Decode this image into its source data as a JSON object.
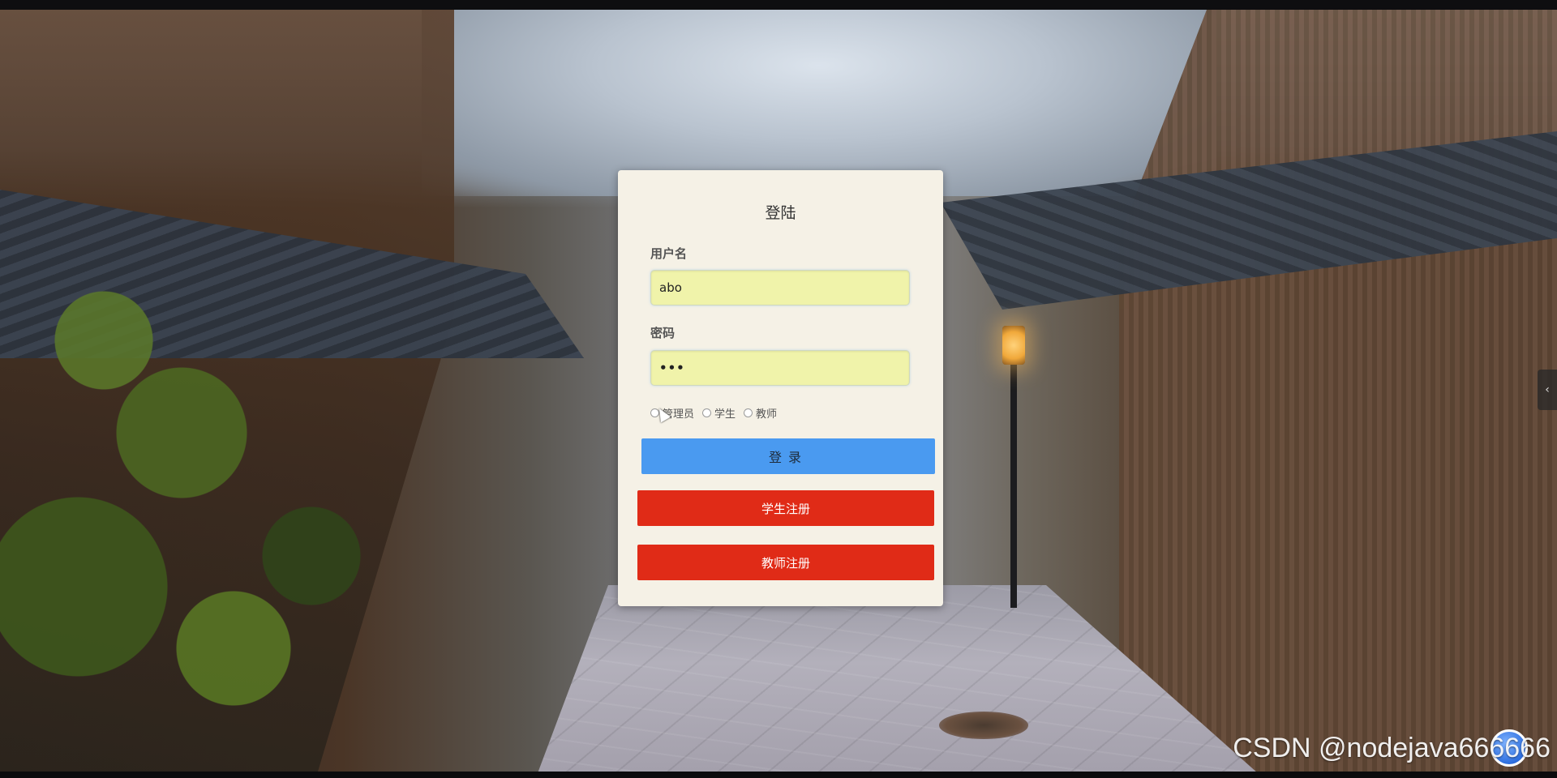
{
  "login_card": {
    "title": "登陆",
    "username_label": "用户名",
    "username_value": "abo",
    "password_label": "密码",
    "password_value": "•••",
    "roles": [
      {
        "label": "管理员",
        "selected": false
      },
      {
        "label": "学生",
        "selected": false
      },
      {
        "label": "教师",
        "selected": false
      }
    ],
    "login_button": "登录",
    "student_register_button": "学生注册",
    "teacher_register_button": "教师注册"
  },
  "side_tab": {
    "icon": "chevron-left-icon",
    "glyph": "‹"
  },
  "watermark": "CSDN @nodejava666666",
  "colors": {
    "card_bg": "#f5f1e6",
    "input_bg": "#f0f3aa",
    "login_button": "#4a9af0",
    "register_button": "#e02b17"
  }
}
